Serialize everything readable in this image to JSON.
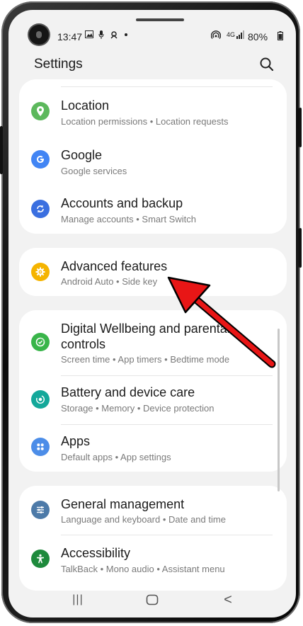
{
  "status_bar": {
    "time": "13:47",
    "battery": "80%",
    "net": "4G",
    "left_icons": [
      "image-icon",
      "mic-icon",
      "voicemail-icon",
      "dot-icon"
    ],
    "right_icons": [
      "hotspot-icon",
      "signal-icon"
    ]
  },
  "header": {
    "title": "Settings"
  },
  "items": [
    {
      "title": "Location",
      "subtitle": "Location permissions  •  Location requests",
      "icon": "location-pin-icon",
      "color": "#5cb85c"
    },
    {
      "title": "Google",
      "subtitle": "Google services",
      "icon": "google-g-icon",
      "color": "#4285f4"
    },
    {
      "title": "Accounts and backup",
      "subtitle": "Manage accounts  •  Smart Switch",
      "icon": "sync-icon",
      "color": "#3a6fe0"
    },
    {
      "title": "Advanced features",
      "subtitle": "Android Auto  •  Side key",
      "icon": "gear-plus-icon",
      "color": "#f5b400"
    },
    {
      "title": "Digital Wellbeing and parental controls",
      "subtitle": "Screen time  •  App timers  •  Bedtime mode",
      "icon": "wellbeing-icon",
      "color": "#39b54a"
    },
    {
      "title": "Battery and device care",
      "subtitle": "Storage  •  Memory  •  Device protection",
      "icon": "device-care-icon",
      "color": "#14a89a"
    },
    {
      "title": "Apps",
      "subtitle": "Default apps  •  App settings",
      "icon": "apps-grid-icon",
      "color": "#4c8de8"
    },
    {
      "title": "General management",
      "subtitle": "Language and keyboard  •  Date and time",
      "icon": "sliders-icon",
      "color": "#4d7aa8"
    },
    {
      "title": "Accessibility",
      "subtitle": "TalkBack  •  Mono audio  •  Assistant menu",
      "icon": "accessibility-icon",
      "color": "#1e8a3c"
    }
  ],
  "nav": {
    "recents": "|||",
    "back": "<"
  }
}
